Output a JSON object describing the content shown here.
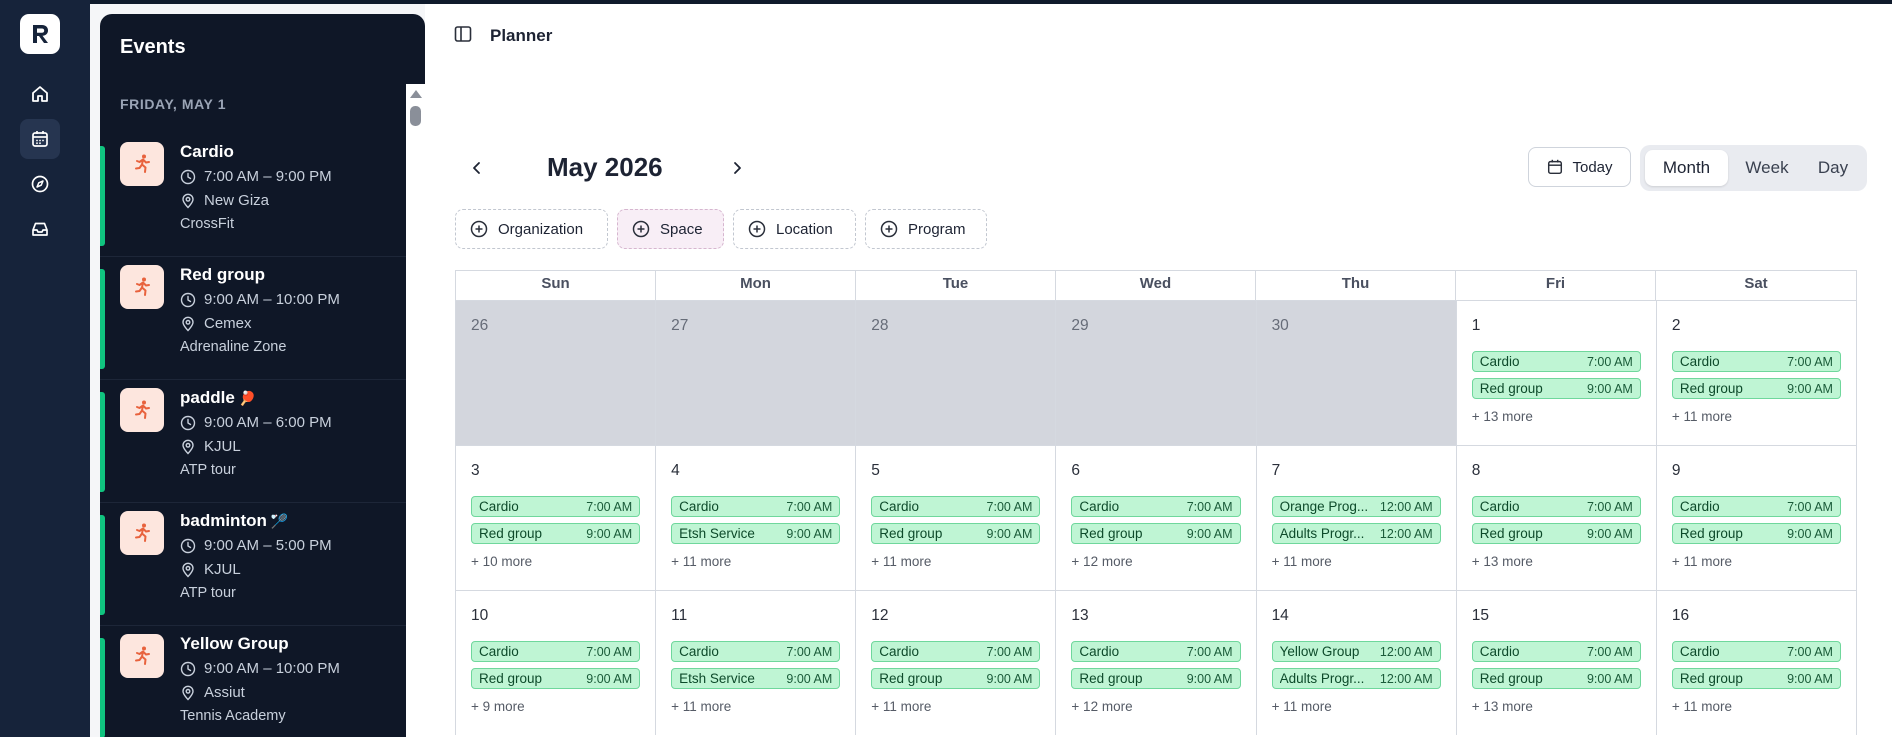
{
  "app": {
    "logo_letter": "R"
  },
  "rail": {
    "items": [
      {
        "icon": "home-icon"
      },
      {
        "icon": "calendar-icon",
        "active": true
      },
      {
        "icon": "compass-icon"
      },
      {
        "icon": "inbox-icon"
      }
    ]
  },
  "events": {
    "title": "Events",
    "date_heading": "FRIDAY, MAY 1",
    "items": [
      {
        "name": "Cardio",
        "emoji": "",
        "time": "7:00 AM – 9:00 PM",
        "location": "New Giza",
        "venue": "CrossFit"
      },
      {
        "name": "Red group",
        "emoji": "",
        "time": "9:00 AM – 10:00 PM",
        "location": "Cemex",
        "venue": "Adrenaline Zone"
      },
      {
        "name": "paddle",
        "emoji": "🏓",
        "time": "9:00 AM – 6:00 PM",
        "location": "KJUL",
        "venue": "ATP tour"
      },
      {
        "name": "badminton",
        "emoji": "🏸",
        "time": "9:00 AM – 5:00 PM",
        "location": "KJUL",
        "venue": "ATP tour"
      },
      {
        "name": "Yellow Group",
        "emoji": "",
        "time": "9:00 AM – 10:00 PM",
        "location": "Assiut",
        "venue": "Tennis Academy"
      }
    ]
  },
  "header": {
    "title": "Planner"
  },
  "calendar": {
    "month_label": "May 2026",
    "today_label": "Today",
    "views": [
      "Month",
      "Week",
      "Day"
    ],
    "selected_view": "Month",
    "filters": [
      "Organization",
      "Space",
      "Location",
      "Program"
    ],
    "active_filter": "Space",
    "weekdays": [
      "Sun",
      "Mon",
      "Tue",
      "Wed",
      "Thu",
      "Fri",
      "Sat"
    ],
    "weeks": [
      [
        {
          "day": "26",
          "out": true,
          "events": [],
          "more": ""
        },
        {
          "day": "27",
          "out": true,
          "events": [],
          "more": ""
        },
        {
          "day": "28",
          "out": true,
          "events": [],
          "more": ""
        },
        {
          "day": "29",
          "out": true,
          "events": [],
          "more": ""
        },
        {
          "day": "30",
          "out": true,
          "events": [],
          "more": ""
        },
        {
          "day": "1",
          "events": [
            {
              "name": "Cardio",
              "time": "7:00 AM"
            },
            {
              "name": "Red group",
              "time": "9:00 AM"
            }
          ],
          "more": "+ 13 more"
        },
        {
          "day": "2",
          "events": [
            {
              "name": "Cardio",
              "time": "7:00 AM"
            },
            {
              "name": "Red group",
              "time": "9:00 AM"
            }
          ],
          "more": "+ 11 more"
        }
      ],
      [
        {
          "day": "3",
          "events": [
            {
              "name": "Cardio",
              "time": "7:00 AM"
            },
            {
              "name": "Red group",
              "time": "9:00 AM"
            }
          ],
          "more": "+ 10 more"
        },
        {
          "day": "4",
          "events": [
            {
              "name": "Cardio",
              "time": "7:00 AM"
            },
            {
              "name": "Etsh Service",
              "time": "9:00 AM"
            }
          ],
          "more": "+ 11 more"
        },
        {
          "day": "5",
          "events": [
            {
              "name": "Cardio",
              "time": "7:00 AM"
            },
            {
              "name": "Red group",
              "time": "9:00 AM"
            }
          ],
          "more": "+ 11 more"
        },
        {
          "day": "6",
          "events": [
            {
              "name": "Cardio",
              "time": "7:00 AM"
            },
            {
              "name": "Red group",
              "time": "9:00 AM"
            }
          ],
          "more": "+ 12 more"
        },
        {
          "day": "7",
          "events": [
            {
              "name": "Orange Prog...",
              "time": "12:00 AM"
            },
            {
              "name": "Adults Progr...",
              "time": "12:00 AM"
            }
          ],
          "more": "+ 11 more"
        },
        {
          "day": "8",
          "events": [
            {
              "name": "Cardio",
              "time": "7:00 AM"
            },
            {
              "name": "Red group",
              "time": "9:00 AM"
            }
          ],
          "more": "+ 13 more"
        },
        {
          "day": "9",
          "events": [
            {
              "name": "Cardio",
              "time": "7:00 AM"
            },
            {
              "name": "Red group",
              "time": "9:00 AM"
            }
          ],
          "more": "+ 11 more"
        }
      ],
      [
        {
          "day": "10",
          "events": [
            {
              "name": "Cardio",
              "time": "7:00 AM"
            },
            {
              "name": "Red group",
              "time": "9:00 AM"
            }
          ],
          "more": "+ 9 more"
        },
        {
          "day": "11",
          "events": [
            {
              "name": "Cardio",
              "time": "7:00 AM"
            },
            {
              "name": "Etsh Service",
              "time": "9:00 AM"
            }
          ],
          "more": "+ 11 more"
        },
        {
          "day": "12",
          "events": [
            {
              "name": "Cardio",
              "time": "7:00 AM"
            },
            {
              "name": "Red group",
              "time": "9:00 AM"
            }
          ],
          "more": "+ 11 more"
        },
        {
          "day": "13",
          "events": [
            {
              "name": "Cardio",
              "time": "7:00 AM"
            },
            {
              "name": "Red group",
              "time": "9:00 AM"
            }
          ],
          "more": "+ 12 more"
        },
        {
          "day": "14",
          "events": [
            {
              "name": "Yellow Group",
              "time": "12:00 AM"
            },
            {
              "name": "Adults Progr...",
              "time": "12:00 AM"
            }
          ],
          "more": "+ 11 more"
        },
        {
          "day": "15",
          "events": [
            {
              "name": "Cardio",
              "time": "7:00 AM"
            },
            {
              "name": "Red group",
              "time": "9:00 AM"
            }
          ],
          "more": "+ 13 more"
        },
        {
          "day": "16",
          "events": [
            {
              "name": "Cardio",
              "time": "7:00 AM"
            },
            {
              "name": "Red group",
              "time": "9:00 AM"
            }
          ],
          "more": "+ 11 more"
        }
      ]
    ]
  },
  "colors": {
    "rail_bg": "#16233a",
    "panel_bg": "#0f1727",
    "accent_green": "#10c47f",
    "event_chip_bg": "#bff5d4",
    "event_chip_border": "#6fd79c",
    "runner_icon": "#e8623d"
  }
}
